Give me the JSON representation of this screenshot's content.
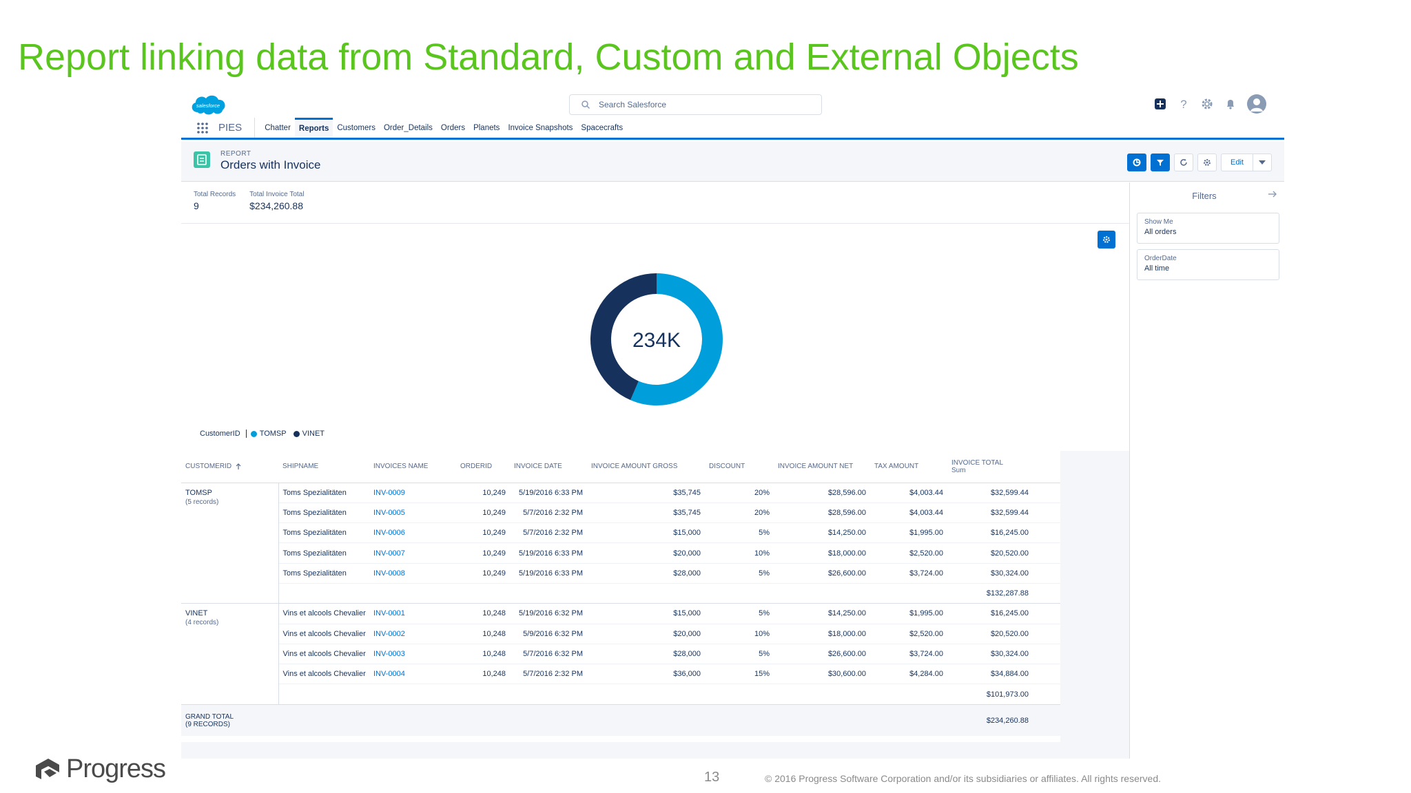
{
  "slide": {
    "title": "Report linking data from Standard, Custom and External Objects",
    "page_number": "13",
    "copyright": "© 2016 Progress Software Corporation and/or its subsidiaries or affiliates. All rights reserved.",
    "brand": "Progress"
  },
  "header": {
    "logo_text": "salesforce",
    "search_placeholder": "Search Salesforce",
    "icons": [
      "plus-icon",
      "help-icon",
      "gear-icon",
      "bell-icon",
      "avatar-icon"
    ]
  },
  "nav": {
    "app_name": "PIES",
    "items": [
      {
        "label": "Chatter",
        "active": false
      },
      {
        "label": "Reports",
        "active": true
      },
      {
        "label": "Customers",
        "active": false
      },
      {
        "label": "Order_Details",
        "active": false
      },
      {
        "label": "Orders",
        "active": false
      },
      {
        "label": "Planets",
        "active": false
      },
      {
        "label": "Invoice Snapshots",
        "active": false
      },
      {
        "label": "Spacecrafts",
        "active": false
      }
    ]
  },
  "report": {
    "type": "REPORT",
    "title": "Orders with Invoice",
    "edit_label": "Edit",
    "summary": [
      {
        "label": "Total Records",
        "value": "9"
      },
      {
        "label": "Total Invoice Total",
        "value": "$234,260.88"
      }
    ]
  },
  "chart_data": {
    "type": "pie",
    "center_label": "234K",
    "legend_title": "CustomerID",
    "slices": [
      {
        "name": "TOMSP",
        "value": 132287.88,
        "color": "#009edb"
      },
      {
        "name": "VINET",
        "value": 101973.0,
        "color": "#16325c"
      }
    ]
  },
  "filters": {
    "title": "Filters",
    "items": [
      {
        "label": "Show Me",
        "value": "All orders"
      },
      {
        "label": "OrderDate",
        "value": "All time"
      }
    ]
  },
  "table": {
    "columns": [
      "CUSTOMERID",
      "SHIPNAME",
      "INVOICES NAME",
      "ORDERID",
      "INVOICE DATE",
      "INVOICE AMOUNT GROSS",
      "DISCOUNT",
      "INVOICE AMOUNT NET",
      "TAX AMOUNT",
      "INVOICE TOTAL"
    ],
    "last_column_sub": "Sum",
    "groups": [
      {
        "name": "TOMSP",
        "count": "(5 records)",
        "subtotal": "$132,287.88",
        "rows": [
          [
            "Toms Spezialitäten",
            "INV-0009",
            "10,249",
            "5/19/2016 6:33 PM",
            "$35,745",
            "20%",
            "$28,596.00",
            "$4,003.44",
            "$32,599.44"
          ],
          [
            "Toms Spezialitäten",
            "INV-0005",
            "10,249",
            "5/7/2016 2:32 PM",
            "$35,745",
            "20%",
            "$28,596.00",
            "$4,003.44",
            "$32,599.44"
          ],
          [
            "Toms Spezialitäten",
            "INV-0006",
            "10,249",
            "5/7/2016 2:32 PM",
            "$15,000",
            "5%",
            "$14,250.00",
            "$1,995.00",
            "$16,245.00"
          ],
          [
            "Toms Spezialitäten",
            "INV-0007",
            "10,249",
            "5/19/2016 6:33 PM",
            "$20,000",
            "10%",
            "$18,000.00",
            "$2,520.00",
            "$20,520.00"
          ],
          [
            "Toms Spezialitäten",
            "INV-0008",
            "10,249",
            "5/19/2016 6:33 PM",
            "$28,000",
            "5%",
            "$26,600.00",
            "$3,724.00",
            "$30,324.00"
          ]
        ]
      },
      {
        "name": "VINET",
        "count": "(4 records)",
        "subtotal": "$101,973.00",
        "rows": [
          [
            "Vins et alcools Chevalier",
            "INV-0001",
            "10,248",
            "5/19/2016 6:32 PM",
            "$15,000",
            "5%",
            "$14,250.00",
            "$1,995.00",
            "$16,245.00"
          ],
          [
            "Vins et alcools Chevalier",
            "INV-0002",
            "10,248",
            "5/9/2016 6:32 PM",
            "$20,000",
            "10%",
            "$18,000.00",
            "$2,520.00",
            "$20,520.00"
          ],
          [
            "Vins et alcools Chevalier",
            "INV-0003",
            "10,248",
            "5/7/2016 6:32 PM",
            "$28,000",
            "5%",
            "$26,600.00",
            "$3,724.00",
            "$30,324.00"
          ],
          [
            "Vins et alcools Chevalier",
            "INV-0004",
            "10,248",
            "5/7/2016 2:32 PM",
            "$36,000",
            "15%",
            "$30,600.00",
            "$4,284.00",
            "$34,884.00"
          ]
        ]
      }
    ],
    "grand_total_label": "GRAND TOTAL",
    "grand_total_count": "(9 RECORDS)",
    "grand_total_value": "$234,260.88"
  }
}
